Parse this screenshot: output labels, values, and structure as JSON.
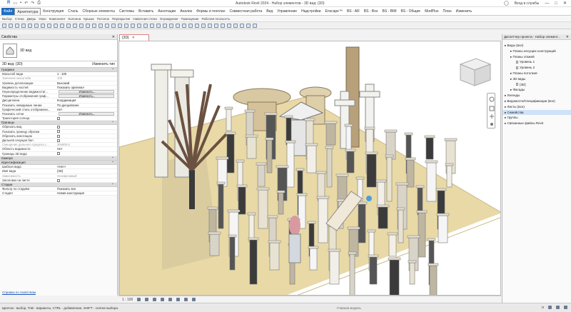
{
  "window": {
    "title": "Autodesk Revit 2024 - Набор элементов - 3D вид: {3D}",
    "user": "Вход в службы"
  },
  "ribbon": {
    "tabs": [
      "Файл",
      "Архитектура",
      "Конструкция",
      "Сталь",
      "Сборные элементы",
      "Системы",
      "Вставить",
      "Аннотации",
      "Анализ",
      "Формы и генплан",
      "Совместная работа",
      "Вид",
      "Управление",
      "Надстройки",
      "Enscape™",
      "BS - AR",
      "BS - Box",
      "BS - BIM",
      "BS - Общие",
      "ModPlus",
      "План",
      "Изменить"
    ]
  },
  "subribbon": {
    "items": [
      "Выбор",
      "Стена",
      "Дверь",
      "Окно",
      "Компонент",
      "Колонна",
      "Крыша",
      "Потолок",
      "Перекрытие",
      "Навесная стена",
      "Ограждение",
      "Помещение",
      "Рабочая плоскость"
    ]
  },
  "properties": {
    "title": "Свойства",
    "type_name": "3D вид",
    "filter_label": "3D вид: {3D}",
    "edit_type": "Изменить тип",
    "sections": [
      {
        "name": "Графика",
        "rows": [
          [
            "Масштаб вида",
            "1 : 100"
          ],
          [
            "Значение масштаба",
            "100"
          ],
          [
            "Уровень детализации",
            "Высокий"
          ],
          [
            "Видимость частей",
            "Показать оригинал"
          ],
          [
            "Переопределение видимости/...",
            "Изменить..."
          ],
          [
            "Параметры отображения граф...",
            "Изменить..."
          ],
          [
            "Дисциплина",
            "Координация"
          ],
          [
            "Показать невидимые линии",
            "По дисциплине"
          ],
          [
            "Графический стиль отображени...",
            "Нет"
          ],
          [
            "Показать сетки",
            "Изменить..."
          ],
          [
            "Траектория солнца",
            ""
          ]
        ]
      },
      {
        "name": "Границы",
        "rows": [
          [
            "Обрезать вид",
            ""
          ],
          [
            "Показать границу обрезки",
            ""
          ],
          [
            "Обрезать аннотацию",
            ""
          ],
          [
            "Дальняя секущая бал",
            ""
          ],
          [
            "Смещение дальнего предела с...",
            "304800.0"
          ],
          [
            "Область видимости",
            "Нет"
          ],
          [
            "Границы 3D вида",
            ""
          ]
        ]
      },
      {
        "name": "Камера",
        "rows": []
      },
      {
        "name": "Идентификация",
        "rows": [
          [
            "Шаблон вида",
            "<Нет>"
          ],
          [
            "Имя вида",
            "{3D}"
          ],
          [
            "Зависимость",
            "Независимый"
          ],
          [
            "Заголовок на листе",
            ""
          ]
        ]
      },
      {
        "name": "Стадии",
        "rows": [
          [
            "Фильтр по стадиям",
            "Показать все"
          ],
          [
            "Стадия",
            "Новая конструкция"
          ]
        ]
      }
    ],
    "help_link": "Справка по свойствам"
  },
  "view": {
    "tab_label": "{3D}",
    "scale": "1 : 100",
    "main_model": "Главная модель"
  },
  "browser": {
    "title": "Диспетчер проекта - Набор элемент...",
    "tree": [
      {
        "label": "Виды (все)",
        "level": 0
      },
      {
        "label": "Планы несущих конструкций",
        "level": 1
      },
      {
        "label": "Планы этажей",
        "level": 1
      },
      {
        "label": "Уровень 1",
        "level": 2
      },
      {
        "label": "Уровень 2",
        "level": 2
      },
      {
        "label": "Планы потолков",
        "level": 1
      },
      {
        "label": "3D виды",
        "level": 1
      },
      {
        "label": "{3D}",
        "level": 2
      },
      {
        "label": "Фасады",
        "level": 1
      },
      {
        "label": "Легенды",
        "level": 0
      },
      {
        "label": "Ведомости/Спецификации (все)",
        "level": 0
      },
      {
        "label": "Листы (все)",
        "level": 0
      },
      {
        "label": "Семейства",
        "level": 0,
        "selected": true
      },
      {
        "label": "Группы",
        "level": 0
      },
      {
        "label": "Связанные файлы Revit",
        "level": 0
      }
    ]
  },
  "status": {
    "text": "Щелчок - выбор, TAB - варианты, CTRL - добавление, SHIFT - снятие выбора.",
    "zero": ":0"
  },
  "colors": {
    "accent": "#1f6dc2",
    "floor": "#e8d9a6",
    "shadow": "#cbbf96"
  }
}
